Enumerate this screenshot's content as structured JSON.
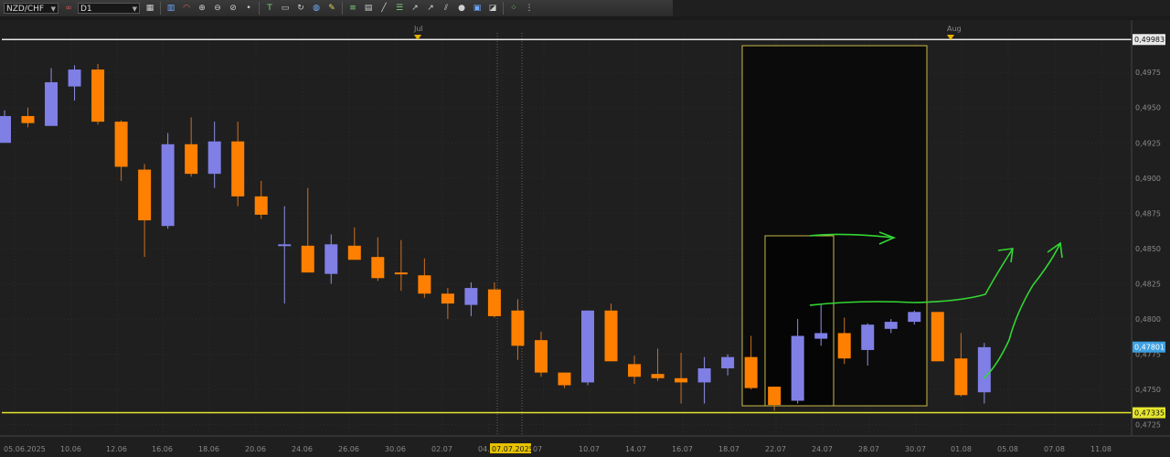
{
  "toolbar": {
    "symbol": "NZD/CHF",
    "timeframe": "D1",
    "icons": [
      "bar-chart-icon",
      "indicator-icon",
      "crosshair-icon",
      "zoom-in-icon",
      "zoom-out-icon",
      "point-icon",
      "text-tool-icon",
      "screenshot-icon",
      "refresh-icon",
      "globe-icon",
      "pencil-icon",
      "drawing-icon",
      "table-icon",
      "line-tool-icon",
      "fib-tool-icon",
      "ray-tool-icon",
      "circle-tool-icon",
      "monitor-icon",
      "eraser-icon",
      "grid-icon"
    ]
  },
  "chart_data": {
    "type": "candlestick",
    "symbol": "NZD/CHF",
    "timeframe": "D1",
    "ylim": [
      0.4717,
      0.5003
    ],
    "y_ticks": [
      "0,4725",
      "0,4750",
      "0,4775",
      "0,4800",
      "0,4825",
      "0,4850",
      "0,4875",
      "0,4900",
      "0,4925",
      "0,4950",
      "0,4975"
    ],
    "x_labels": [
      "05.06.2025",
      "10.06",
      "12.06",
      "16.06",
      "18.06",
      "20.06",
      "24.06",
      "26.06",
      "30.06",
      "02.07",
      "04.07",
      "07.07.2025",
      "07",
      "10.07",
      "14.07",
      "16.07",
      "18.07",
      "22.07",
      "24.07",
      "28.07",
      "30.07",
      "01.08",
      "05.08",
      "07.08",
      "11.08"
    ],
    "month_labels": [
      "Jul",
      "Aug"
    ],
    "current_price_label": "0,47801",
    "high_line_label": "0,49983",
    "low_line_label": "0,47335",
    "high_line_value": 0.49983,
    "low_line_value": 0.47335,
    "current_price": 0.47801,
    "candles": [
      {
        "o": 0.4925,
        "h": 0.4948,
        "l": 0.4925,
        "c": 0.4944
      },
      {
        "o": 0.4944,
        "h": 0.495,
        "l": 0.4936,
        "c": 0.4939
      },
      {
        "o": 0.4937,
        "h": 0.4978,
        "l": 0.4937,
        "c": 0.4968
      },
      {
        "o": 0.4965,
        "h": 0.498,
        "l": 0.4955,
        "c": 0.4977
      },
      {
        "o": 0.4977,
        "h": 0.4981,
        "l": 0.4938,
        "c": 0.494
      },
      {
        "o": 0.494,
        "h": 0.4941,
        "l": 0.4898,
        "c": 0.4908
      },
      {
        "o": 0.4906,
        "h": 0.491,
        "l": 0.4844,
        "c": 0.487
      },
      {
        "o": 0.4866,
        "h": 0.4932,
        "l": 0.4864,
        "c": 0.4924
      },
      {
        "o": 0.4924,
        "h": 0.4943,
        "l": 0.4901,
        "c": 0.4903
      },
      {
        "o": 0.4903,
        "h": 0.494,
        "l": 0.4893,
        "c": 0.4926
      },
      {
        "o": 0.4926,
        "h": 0.494,
        "l": 0.488,
        "c": 0.4887
      },
      {
        "o": 0.4887,
        "h": 0.4898,
        "l": 0.4871,
        "c": 0.4874
      },
      {
        "o": 0.4852,
        "h": 0.488,
        "l": 0.4811,
        "c": 0.4853
      },
      {
        "o": 0.4852,
        "h": 0.4893,
        "l": 0.4833,
        "c": 0.4833
      },
      {
        "o": 0.4832,
        "h": 0.486,
        "l": 0.4825,
        "c": 0.4853
      },
      {
        "o": 0.4852,
        "h": 0.4865,
        "l": 0.4843,
        "c": 0.4842
      },
      {
        "o": 0.4844,
        "h": 0.4858,
        "l": 0.4827,
        "c": 0.4829
      },
      {
        "o": 0.4833,
        "h": 0.4856,
        "l": 0.482,
        "c": 0.4832
      },
      {
        "o": 0.4831,
        "h": 0.4843,
        "l": 0.4815,
        "c": 0.4818
      },
      {
        "o": 0.4818,
        "h": 0.4822,
        "l": 0.48,
        "c": 0.4811
      },
      {
        "o": 0.481,
        "h": 0.4826,
        "l": 0.4802,
        "c": 0.4822
      },
      {
        "o": 0.4821,
        "h": 0.4826,
        "l": 0.4801,
        "c": 0.4802
      },
      {
        "o": 0.4806,
        "h": 0.4814,
        "l": 0.4771,
        "c": 0.4781
      },
      {
        "o": 0.4785,
        "h": 0.4791,
        "l": 0.4759,
        "c": 0.4762
      },
      {
        "o": 0.4762,
        "h": 0.4762,
        "l": 0.4751,
        "c": 0.4753
      },
      {
        "o": 0.4755,
        "h": 0.4806,
        "l": 0.4753,
        "c": 0.4806
      },
      {
        "o": 0.4806,
        "h": 0.4811,
        "l": 0.477,
        "c": 0.477
      },
      {
        "o": 0.4768,
        "h": 0.4774,
        "l": 0.4754,
        "c": 0.4759
      },
      {
        "o": 0.4761,
        "h": 0.4779,
        "l": 0.4756,
        "c": 0.4758
      },
      {
        "o": 0.4758,
        "h": 0.4776,
        "l": 0.474,
        "c": 0.4755
      },
      {
        "o": 0.4755,
        "h": 0.4773,
        "l": 0.474,
        "c": 0.4765
      },
      {
        "o": 0.4765,
        "h": 0.4775,
        "l": 0.476,
        "c": 0.4773
      },
      {
        "o": 0.4773,
        "h": 0.4788,
        "l": 0.475,
        "c": 0.4751
      },
      {
        "o": 0.4752,
        "h": 0.4752,
        "l": 0.4735,
        "c": 0.4739
      },
      {
        "o": 0.4742,
        "h": 0.48,
        "l": 0.474,
        "c": 0.4788
      },
      {
        "o": 0.4786,
        "h": 0.481,
        "l": 0.4781,
        "c": 0.479
      },
      {
        "o": 0.479,
        "h": 0.4801,
        "l": 0.4768,
        "c": 0.4772
      },
      {
        "o": 0.4778,
        "h": 0.4797,
        "l": 0.4767,
        "c": 0.4796
      },
      {
        "o": 0.4793,
        "h": 0.48,
        "l": 0.479,
        "c": 0.4798
      },
      {
        "o": 0.4798,
        "h": 0.4806,
        "l": 0.4796,
        "c": 0.4805
      },
      {
        "o": 0.4805,
        "h": 0.4805,
        "l": 0.477,
        "c": 0.477
      },
      {
        "o": 0.4772,
        "h": 0.479,
        "l": 0.4745,
        "c": 0.4746
      },
      {
        "o": 0.4748,
        "h": 0.4783,
        "l": 0.474,
        "c": 0.478
      }
    ],
    "colors": {
      "bull": "#7f7fe6",
      "bear": "#ff8000",
      "wick_bull": "#8f8fe8",
      "wick_bear": "#d07020",
      "grid": "#2b2b2b",
      "background": "#1f1f1f",
      "axis_text": "#8a8a8a",
      "high_line": "#e8e8e8",
      "low_line": "#e6e62e",
      "annotation": "#33d633",
      "price_tag": "#3ea0e0",
      "zone_border": "#c8b84a"
    },
    "grid": true
  }
}
